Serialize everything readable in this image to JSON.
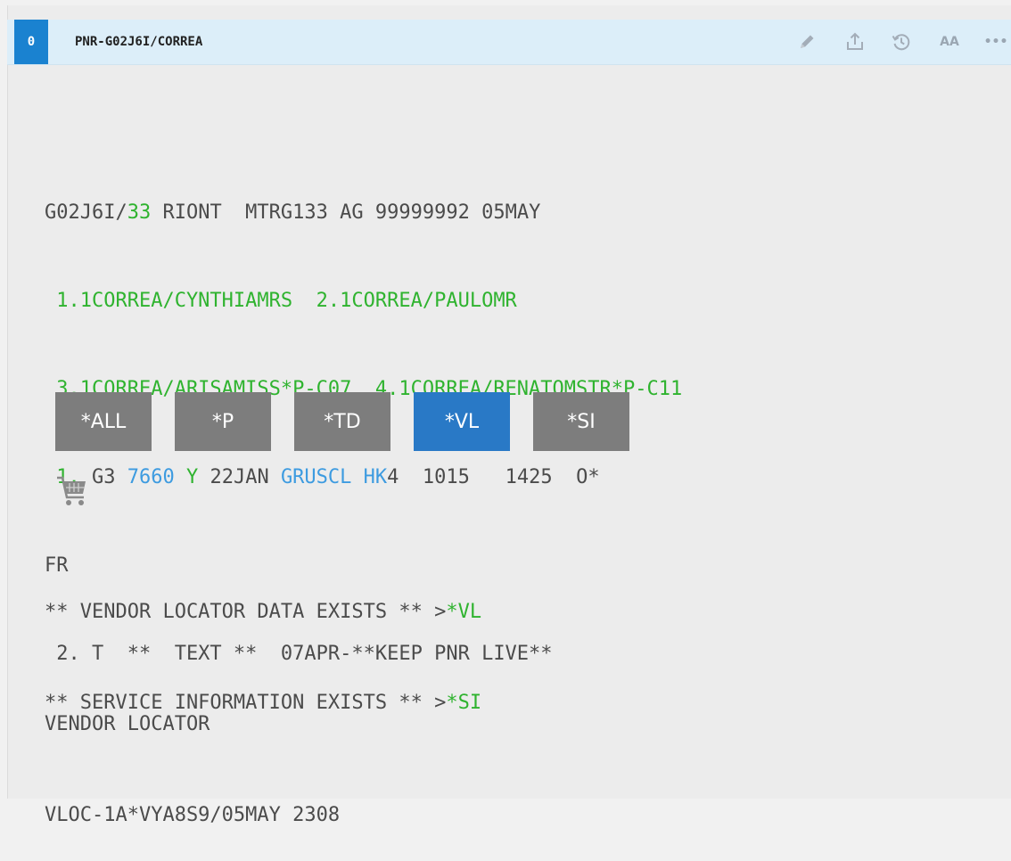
{
  "window": {
    "tab_badge": "0",
    "title": "PNR-G02J6I/CORREA",
    "toolbar_icons": [
      "pencil-icon",
      "share-icon",
      "history-icon",
      "font-size-icon",
      "more-icon"
    ],
    "font_size_label": "AA",
    "more_label": "•••"
  },
  "pnr": {
    "header": {
      "record": "G02J6I/",
      "num": "33",
      "rest": " RIONT  MTRG133 AG 99999992 05MAY"
    },
    "passengers_line1": " 1.1CORREA/CYNTHIAMRS  2.1CORREA/PAULOMR",
    "passengers_line2": " 3.1CORREA/ARISAMISS*P-C07  4.1CORREA/RENATOMSTR*P-C11",
    "segment": {
      "num": " 1.",
      "airline": " G3 ",
      "flight": "7660",
      "space1": " ",
      "class": "Y",
      "date": " 22JAN ",
      "route": "GRUSCL",
      "space2": " ",
      "status": "HK",
      "rest": "4  1015   1425  O*"
    },
    "segment_cont": "FR",
    "remark": " 2. T  **  TEXT **  07APR-**KEEP PNR LIVE**"
  },
  "buttons": [
    {
      "label": "*ALL",
      "active": false
    },
    {
      "label": "*P",
      "active": false
    },
    {
      "label": "*TD",
      "active": false
    },
    {
      "label": "*VL",
      "active": true
    },
    {
      "label": "*SI",
      "active": false
    }
  ],
  "cart_icon": "shopping-cart-icon",
  "exists": {
    "vl_text": "** VENDOR LOCATOR DATA EXISTS ** >",
    "vl_link": "*VL",
    "si_text": "** SERVICE INFORMATION EXISTS ** >",
    "si_link": "*SI"
  },
  "vendor": {
    "title": "VENDOR LOCATOR",
    "locator": "VLOC-1A*VYA8S9/05MAY 2308"
  },
  "colors": {
    "accent_blue": "#1a82d0",
    "active_button": "#2979c6",
    "inactive_button": "#7d7d7d",
    "green_text": "#2fb32f",
    "blue_text": "#3d9be0",
    "titlebar": "#dceef9"
  }
}
